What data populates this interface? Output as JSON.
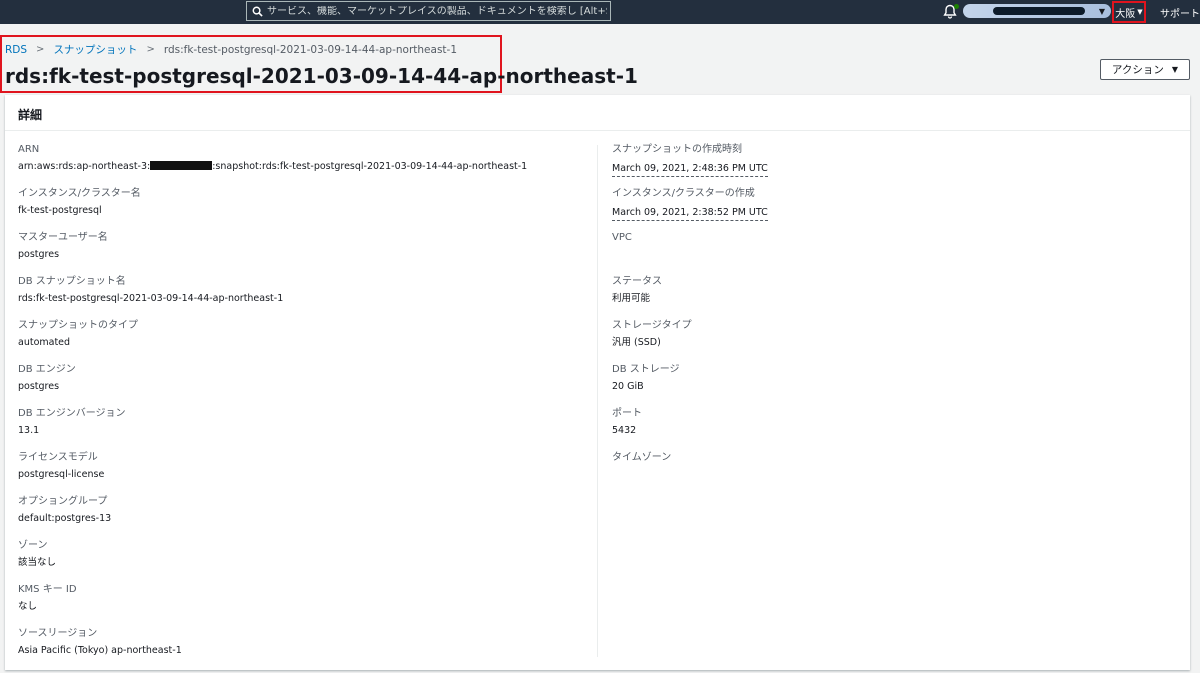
{
  "topbar": {
    "search_placeholder": "サービス、機能、マーケットプレイスの製品、ドキュメントを検索し [Alt+S]",
    "region_label": "大阪",
    "support_label": "サポート"
  },
  "breadcrumb": {
    "rds": "RDS",
    "snapshots": "スナップショット",
    "current": "rds:fk-test-postgresql-2021-03-09-14-44-ap-northeast-1"
  },
  "page_title": "rds:fk-test-postgresql-2021-03-09-14-44-ap-northeast-1",
  "action_button": "アクション",
  "panel_title": "詳細",
  "left_fields": [
    {
      "label": "ARN",
      "value_prefix": "arn:aws:rds:ap-northeast-3:",
      "value_suffix": ":snapshot:rds:fk-test-postgresql-2021-03-09-14-44-ap-northeast-1"
    },
    {
      "label": "インスタンス/クラスター名",
      "value": "fk-test-postgresql"
    },
    {
      "label": "マスターユーザー名",
      "value": "postgres"
    },
    {
      "label": "DB スナップショット名",
      "value": "rds:fk-test-postgresql-2021-03-09-14-44-ap-northeast-1"
    },
    {
      "label": "スナップショットのタイプ",
      "value": "automated"
    },
    {
      "label": "DB エンジン",
      "value": "postgres"
    },
    {
      "label": "DB エンジンバージョン",
      "value": "13.1"
    },
    {
      "label": "ライセンスモデル",
      "value": "postgresql-license"
    },
    {
      "label": "オプショングループ",
      "value": "default:postgres-13"
    },
    {
      "label": "ゾーン",
      "value": "該当なし"
    },
    {
      "label": "KMS キー ID",
      "value": "なし"
    },
    {
      "label": "ソースリージョン",
      "value": "Asia Pacific (Tokyo) ap-northeast-1"
    }
  ],
  "right_fields": [
    {
      "label": "スナップショットの作成時刻",
      "value": "March 09, 2021, 2:48:36 PM UTC"
    },
    {
      "label": "インスタンス/クラスターの作成",
      "value": "March 09, 2021, 2:38:52 PM UTC"
    },
    {
      "label": "VPC",
      "value": ""
    },
    {
      "label": "ステータス",
      "value": "利用可能"
    },
    {
      "label": "ストレージタイプ",
      "value": "汎用 (SSD)"
    },
    {
      "label": "DB ストレージ",
      "value": "20 GiB"
    },
    {
      "label": "ポート",
      "value": "5432"
    },
    {
      "label": "タイムゾーン",
      "value": ""
    }
  ],
  "icons": {
    "search": "search-icon",
    "bell": "bell-icon",
    "caret": "caret-down-icon",
    "chevron": "chevron-right-icon"
  },
  "colors": {
    "topbar": "#232f3e",
    "link": "#0073bb",
    "highlight": "#e0141e",
    "notification_dot": "#1d8102"
  }
}
